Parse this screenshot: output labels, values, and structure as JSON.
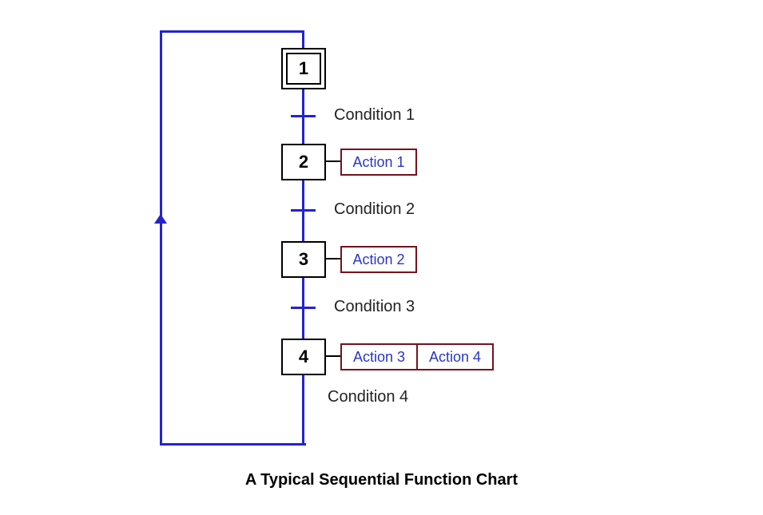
{
  "caption": "A Typical Sequential Function Chart",
  "colors": {
    "line": "#2323d1",
    "action_border": "#75121f",
    "action_text": "#2a36c4",
    "step_border": "#000000"
  },
  "steps": [
    {
      "id": 1,
      "label": "1",
      "initial": true
    },
    {
      "id": 2,
      "label": "2",
      "initial": false
    },
    {
      "id": 3,
      "label": "3",
      "initial": false
    },
    {
      "id": 4,
      "label": "4",
      "initial": false
    }
  ],
  "conditions": [
    {
      "id": 1,
      "label": "Condition 1"
    },
    {
      "id": 2,
      "label": "Condition 2"
    },
    {
      "id": 3,
      "label": "Condition 3"
    },
    {
      "id": 4,
      "label": "Condition 4"
    }
  ],
  "actions": [
    {
      "step": 2,
      "labels": [
        "Action 1"
      ]
    },
    {
      "step": 3,
      "labels": [
        "Action 2"
      ]
    },
    {
      "step": 4,
      "labels": [
        "Action 3",
        "Action 4"
      ]
    }
  ]
}
